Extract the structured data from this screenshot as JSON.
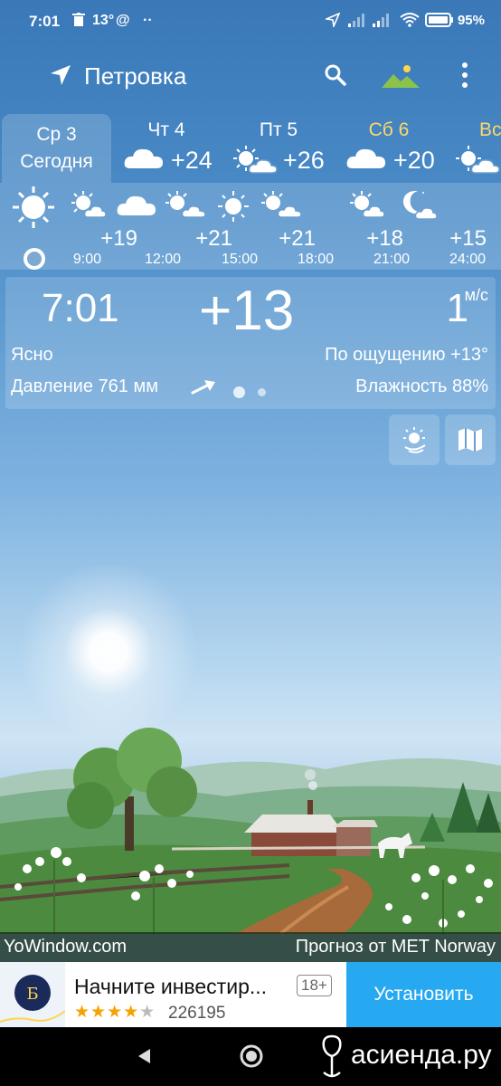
{
  "status_bar": {
    "time": "7:01",
    "temp_badge": "13°",
    "battery": "95"
  },
  "toolbar": {
    "location": "Петровка"
  },
  "days": {
    "selected": {
      "day": "Ср 3",
      "label": "Сегодня"
    },
    "items": [
      {
        "day": "Чт 4",
        "temp": "+24",
        "icon": "partly-cloudy-icon"
      },
      {
        "day": "Пт 5",
        "temp": "+26",
        "icon": "sun-cloud-icon"
      },
      {
        "day": "Сб 6",
        "temp": "+20",
        "icon": "cloud-icon",
        "color": "#ffd766"
      },
      {
        "day": "Вс",
        "temp": "",
        "icon": "sun-cloud-icon",
        "color": "#ffd766"
      }
    ]
  },
  "hourly": [
    {
      "time": "9:00",
      "temp": "+19"
    },
    {
      "time": "12:00",
      "temp": ""
    },
    {
      "time": "15:00",
      "temp": "+21"
    },
    {
      "time": "18:00",
      "temp": "+21"
    },
    {
      "time": "21:00",
      "temp": "+18"
    },
    {
      "time": "24:00",
      "temp": "+15"
    }
  ],
  "current": {
    "time": "7:01",
    "temp": "+13",
    "wind": "1",
    "wind_unit": "м/с",
    "condition": "Ясно",
    "feels_like": "По ощущению +13°",
    "pressure": "Давление 761 мм",
    "humidity": "Влажность 88%"
  },
  "credits": {
    "left": "YoWindow.com",
    "right": "Прогноз от MET Norway"
  },
  "ad": {
    "title": "Начните инвестир...",
    "age": "18+",
    "rating": 4,
    "count": "226195",
    "button": "Установить"
  },
  "watermark": "асиенда.ру"
}
